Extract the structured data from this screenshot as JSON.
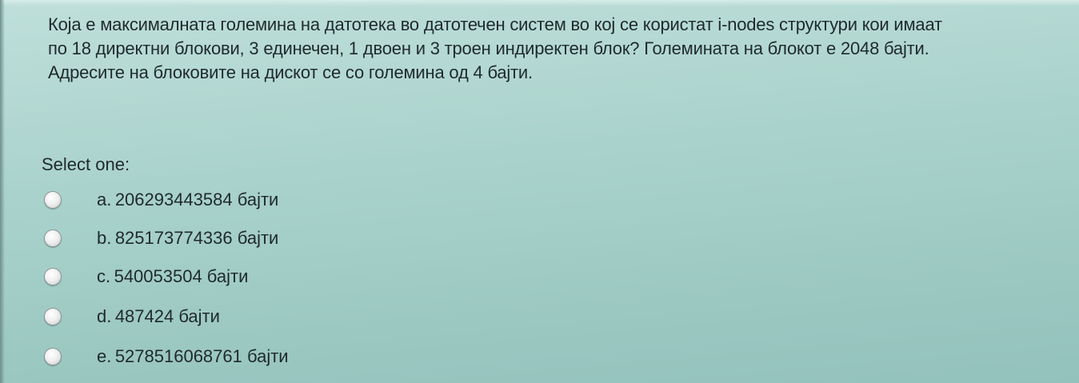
{
  "question": {
    "lines": [
      "Која е максималната големина на датотека во датотечен систем  во кој се користат i-nodes структури кои имаат",
      "по 18 директни блокови, 3 единечен, 1 двоен и 3 троен индиректен блок? Големината на блокот е 2048 бајти.",
      "Адресите на блоковите на дискот се со големина од 4 бајти."
    ]
  },
  "prompt": "Select one:",
  "options": [
    {
      "letter": "a.",
      "text": "206293443584 бајти"
    },
    {
      "letter": "b.",
      "text": "825173774336 бајти"
    },
    {
      "letter": "c.",
      "text": "540053504 бајти"
    },
    {
      "letter": "d.",
      "text": "487424 бајти"
    },
    {
      "letter": "e.",
      "text": "5278516068761 бајти"
    }
  ]
}
